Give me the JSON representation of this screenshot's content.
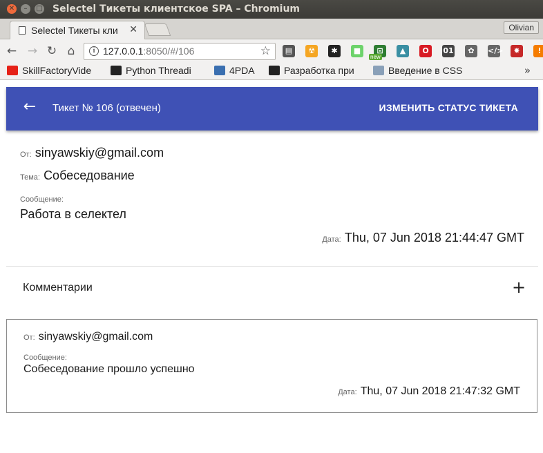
{
  "window": {
    "title": "Selectel Тикеты клиентское SPA – Chromium"
  },
  "browser": {
    "tab_title": "Selectel Тикеты кли",
    "profile_name": "Olivian",
    "url_host": "127.0.0.1",
    "url_path": ":8050/#/106",
    "extensions": [
      {
        "icon": "radio-icon",
        "color": "#555555"
      },
      {
        "icon": "radiation-icon",
        "color": "#f5a623"
      },
      {
        "icon": "paw-icon",
        "color": "#222222"
      },
      {
        "icon": "green-square-icon",
        "color": "#6dd36b"
      },
      {
        "icon": "frame-icon",
        "color": "#2e7d32"
      },
      {
        "icon": "alpine-icon",
        "color": "#3a8fa3"
      },
      {
        "icon": "opera-icon",
        "color": "#d81b24"
      },
      {
        "icon": "binary-icon",
        "color": "#444444"
      },
      {
        "icon": "gear-icon",
        "color": "#666666"
      },
      {
        "icon": "code-icon",
        "color": "#666666"
      },
      {
        "icon": "bug-icon",
        "color": "#c62828"
      },
      {
        "icon": "alert-icon",
        "color": "#f57c00"
      }
    ],
    "ext_new_badge": "new",
    "bookmarks": [
      {
        "label": "SkillFactoryVide",
        "icon": "youtube-icon",
        "color": "#e62117"
      },
      {
        "label": "Python Threadi",
        "icon": "bars-icon",
        "color": "#222222"
      },
      {
        "label": "4PDA",
        "icon": "4pda-icon",
        "color": "#3a6fb0"
      },
      {
        "label": "Разработка при",
        "icon": "frame-icon",
        "color": "#222222"
      },
      {
        "label": "Введение в CSS",
        "icon": "h-icon",
        "color": "#8aa0b8"
      }
    ],
    "bookmarks_more": "»"
  },
  "appbar": {
    "back_icon": "←",
    "title": "Тикет № 106 (отвечен)",
    "status_button": "ИЗМЕНИТЬ СТАТУС ТИКЕТА",
    "color": "#3f51b5"
  },
  "ticket": {
    "from_label": "От:",
    "from": "sinyawskiy@gmail.com",
    "subject_label": "Тема:",
    "subject": "Собеседование",
    "message_label": "Сообщение:",
    "message": "Работа в селектел",
    "date_label": "Дата:",
    "date": "Thu, 07 Jun 2018 21:44:47 GMT"
  },
  "comments": {
    "title": "Комментарии",
    "add_icon": "+",
    "items": [
      {
        "from_label": "От:",
        "from": "sinyawskiy@gmail.com",
        "message_label": "Сообщение:",
        "message": "Собеседование прошло успешно",
        "date_label": "Дата:",
        "date": "Thu, 07 Jun 2018 21:47:32 GMT"
      }
    ]
  }
}
